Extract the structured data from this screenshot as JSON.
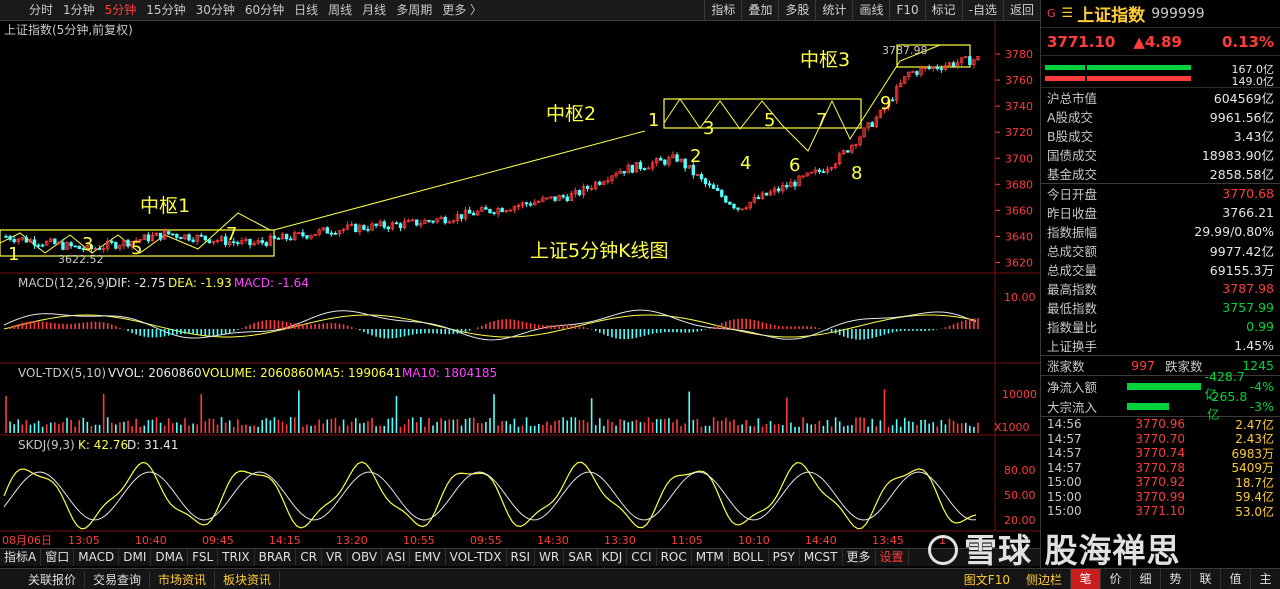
{
  "toolbar": {
    "periods": [
      "分时",
      "1分钟",
      "5分钟",
      "15分钟",
      "30分钟",
      "60分钟",
      "日线",
      "周线",
      "月线",
      "多周期",
      "更多 〉"
    ],
    "active_period": 2,
    "tools": [
      "指标",
      "叠加",
      "多股",
      "统计",
      "画线",
      "F10",
      "标记",
      "-自选",
      "返回"
    ]
  },
  "chart": {
    "title": "上证指数(5分钟,前复权)",
    "main_label": "上证5分钟K线图",
    "price_axis": [
      "3780",
      "3760",
      "3740",
      "3720",
      "3700",
      "3680",
      "3660",
      "3640",
      "3620"
    ],
    "high_mark": "3787.98",
    "low_mark": "3622.52",
    "zones": [
      {
        "label": "中枢1",
        "points": [
          "1",
          "3",
          "5",
          "7"
        ]
      },
      {
        "label": "中枢2",
        "points": [
          "1",
          "3",
          "5",
          "7"
        ],
        "below": [
          "2",
          "4",
          "6",
          "8",
          "9"
        ]
      },
      {
        "label": "中枢3"
      }
    ],
    "macd": {
      "label": "MACD(12,26,9)",
      "dif": "DIF: -2.75",
      "dea": "DEA: -1.93",
      "macd": "MACD: -1.64",
      "axis": "10.00"
    },
    "vol": {
      "label": "VOL-TDX(5,10)",
      "vvol": "VVOL: 2060860",
      "volume": "VOLUME: 2060860",
      "ma5": "MA5: 1990641",
      "ma10": "MA10: 1804185",
      "axis": "10000",
      "unit": "X1000"
    },
    "skdj": {
      "label": "SKDJ(9,3)",
      "k": "K: 42.76",
      "d": "D: 31.41",
      "axis": [
        "80.00",
        "50.00",
        "20.00"
      ]
    },
    "time_axis": [
      "08月06日",
      "13:05",
      "10:40",
      "09:45",
      "14:15",
      "13:20",
      "10:55",
      "09:55",
      "14:30",
      "13:30",
      "11:05",
      "10:10",
      "14:40",
      "13:45",
      "1"
    ],
    "colors": {
      "up": "#ff3b3b",
      "down": "#54ffff",
      "k": "#ffff44",
      "d": "#e6e6e6",
      "zone": "#ffff44"
    }
  },
  "indicator_tabs": [
    "指标A",
    "窗口",
    "MACD",
    "DMI",
    "DMA",
    "FSL",
    "TRIX",
    "BRAR",
    "CR",
    "VR",
    "OBV",
    "ASI",
    "EMV",
    "VOL-TDX",
    "RSI",
    "WR",
    "SAR",
    "KDJ",
    "CCI",
    "ROC",
    "MTM",
    "BOLL",
    "PSY",
    "MCST",
    "更多",
    "设置"
  ],
  "right_panel": {
    "name": "上证指数",
    "code": "999999",
    "price": "3771.10",
    "change": "▲4.89",
    "pct": "0.13%",
    "bar_up_val": "167.0亿",
    "bar_down_val": "149.0亿",
    "stats": [
      {
        "k": "沪总市值",
        "v": "604569亿",
        "c": "white"
      },
      {
        "k": "A股成交",
        "v": "9961.56亿",
        "c": "white"
      },
      {
        "k": "B股成交",
        "v": "3.43亿",
        "c": "white"
      },
      {
        "k": "国债成交",
        "v": "18983.90亿",
        "c": "white"
      },
      {
        "k": "基金成交",
        "v": "2858.58亿",
        "c": "white"
      }
    ],
    "stats2": [
      {
        "k": "今日开盘",
        "v": "3770.68",
        "c": "red"
      },
      {
        "k": "昨日收盘",
        "v": "3766.21",
        "c": "white"
      },
      {
        "k": "指数振幅",
        "v": "29.99/0.80%",
        "c": "white"
      },
      {
        "k": "总成交额",
        "v": "9977.42亿",
        "c": "white"
      },
      {
        "k": "总成交量",
        "v": "69155.3万",
        "c": "white"
      },
      {
        "k": "最高指数",
        "v": "3787.98",
        "c": "red"
      },
      {
        "k": "最低指数",
        "v": "3757.99",
        "c": "green"
      },
      {
        "k": "指数量比",
        "v": "0.99",
        "c": "green"
      },
      {
        "k": "上证换手",
        "v": "1.45%",
        "c": "white"
      }
    ],
    "rise_label": "涨家数",
    "rise_val": "997",
    "fall_label": "跌家数",
    "fall_val": "1245",
    "net_inflow_label": "净流入额",
    "net_inflow_val": "-428.7亿",
    "net_inflow_pct": "-4%",
    "block_label": "大宗流入",
    "block_val": "-265.8亿",
    "block_pct": "-3%",
    "ticks": [
      {
        "t": "14:56",
        "p": "3770.96",
        "v": "2.47亿"
      },
      {
        "t": "14:57",
        "p": "3770.70",
        "v": "2.43亿"
      },
      {
        "t": "14:57",
        "p": "3770.74",
        "v": "6983万"
      },
      {
        "t": "14:57",
        "p": "3770.78",
        "v": "5409万"
      },
      {
        "t": "15:00",
        "p": "3770.92",
        "v": "18.7亿"
      },
      {
        "t": "15:00",
        "p": "3770.99",
        "v": "59.4亿"
      },
      {
        "t": "15:00",
        "p": "3771.10",
        "v": "53.0亿"
      }
    ]
  },
  "status": {
    "tabs": [
      "关联报价",
      "交易查询",
      "市场资讯",
      "板块资讯"
    ],
    "links": [
      "图文F10",
      "侧边栏"
    ],
    "buttons": [
      "笔",
      "价",
      "细",
      "势",
      "联",
      "值",
      "主"
    ],
    "active_button": 0
  },
  "watermark": "雪球 股海禅思"
}
